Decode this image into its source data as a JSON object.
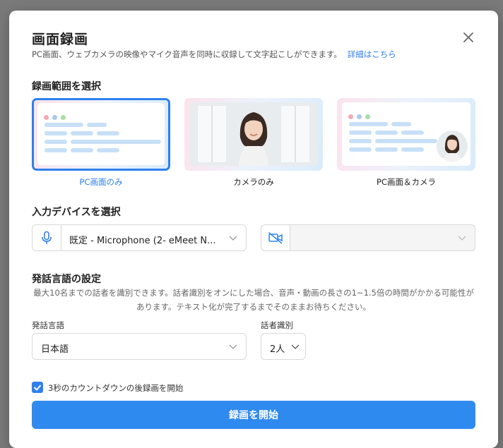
{
  "dialog": {
    "title": "画面録画",
    "subtitle": "PC画面、ウェブカメラの映像やマイク音声を同時に収録して文字起こしができます。",
    "details_link": "詳細はこちら"
  },
  "range": {
    "heading": "録画範囲を選択",
    "options": [
      {
        "label": "PC画面のみ",
        "selected": true
      },
      {
        "label": "カメラのみ",
        "selected": false
      },
      {
        "label": "PC画面＆カメラ",
        "selected": false
      }
    ]
  },
  "devices": {
    "heading": "入力デバイスを選択",
    "microphone_value": "既定 - Microphone (2- eMeet N...",
    "camera_value": ""
  },
  "language": {
    "heading": "発話言語の設定",
    "description": "最大10名までの話者を識別できます。話者識別をオンにした場合、音声・動画の長さの1~1.5倍の時間がかかる可能性があります。テキスト化が完了するまでそのままお待ちください。",
    "language_label": "発話言語",
    "language_value": "日本語",
    "speaker_label": "話者識別",
    "speaker_value": "2人"
  },
  "countdown": {
    "label": "3秒のカウントダウンの後録画を開始",
    "checked": true
  },
  "start_button": "録画を開始",
  "colors": {
    "accent": "#2f80ed",
    "button": "#2f8af0"
  }
}
